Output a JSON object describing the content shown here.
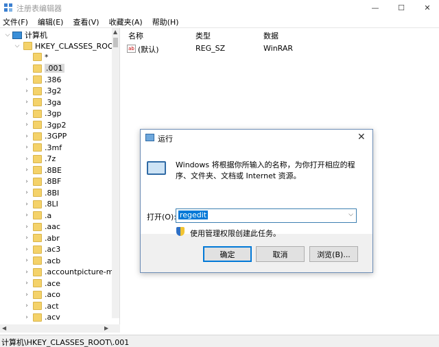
{
  "window": {
    "title": "注册表编辑器",
    "minimize": "—",
    "maximize": "☐",
    "close": "✕"
  },
  "menu": [
    "文件(F)",
    "编辑(E)",
    "查看(V)",
    "收藏夹(A)",
    "帮助(H)"
  ],
  "tree": {
    "root": "计算机",
    "hive": "HKEY_CLASSES_ROOT",
    "items": [
      "*",
      ".001",
      ".386",
      ".3g2",
      ".3ga",
      ".3gp",
      ".3gp2",
      ".3GPP",
      ".3mf",
      ".7z",
      ".8BE",
      ".8BF",
      ".8BI",
      ".8LI",
      ".a",
      ".aac",
      ".abr",
      ".ac3",
      ".acb",
      ".accountpicture-ms",
      ".ace",
      ".aco",
      ".act",
      ".acv"
    ],
    "selected": ".001"
  },
  "list": {
    "headers": {
      "name": "名称",
      "type": "类型",
      "data": "数据"
    },
    "rows": [
      {
        "name": "(默认)",
        "type": "REG_SZ",
        "data": "WinRAR"
      }
    ]
  },
  "status": "计算机\\HKEY_CLASSES_ROOT\\.001",
  "run_dialog": {
    "title": "运行",
    "description": "Windows 将根据你所输入的名称，为你打开相应的程序、文件夹、文档或 Internet 资源。",
    "open_label": "打开(O):",
    "input_value": "regedit",
    "admin_note": "使用管理权限创建此任务。",
    "ok": "确定",
    "cancel": "取消",
    "browse": "浏览(B)..."
  }
}
